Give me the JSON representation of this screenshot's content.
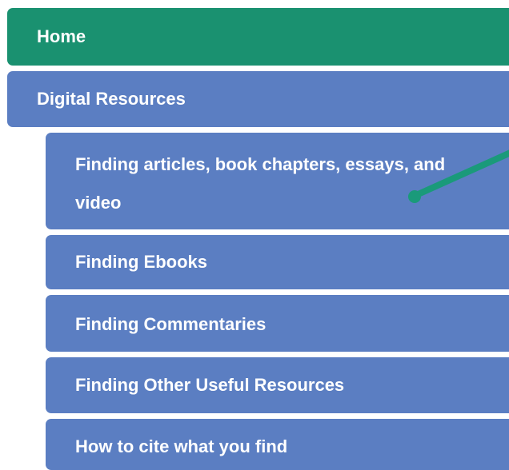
{
  "nav": {
    "home": "Home",
    "digital_resources": "Digital Resources",
    "sub_items": [
      "Finding articles, book chapters, essays, and video",
      "Finding Ebooks",
      "Finding Commentaries",
      "Finding Other Useful Resources",
      "How to cite what you find"
    ]
  },
  "colors": {
    "home_bg": "#1a9170",
    "item_bg": "#5b7ec2",
    "text": "#ffffff",
    "arrow": "#1a9a7a"
  },
  "annotation": {
    "icon": "pointer-arrow-icon"
  }
}
